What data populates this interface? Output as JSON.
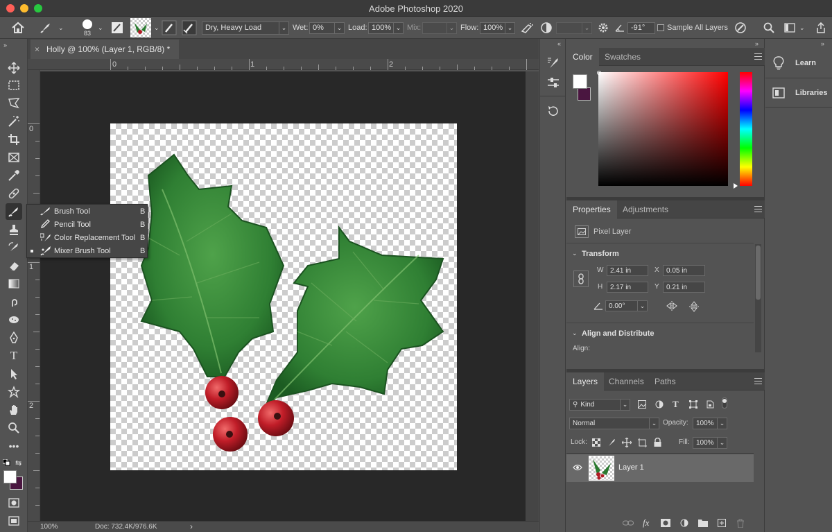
{
  "app": {
    "title": "Adobe Photoshop 2020"
  },
  "options_bar": {
    "brush_size": "83",
    "mix_preset": "Dry, Heavy Load",
    "wet_label": "Wet:",
    "wet_value": "0%",
    "load_label": "Load:",
    "load_value": "100%",
    "mix_label": "Mix:",
    "mix_value": "",
    "flow_label": "Flow:",
    "flow_value": "100%",
    "angle_value": "-91°",
    "sample_all_layers": "Sample All Layers"
  },
  "document": {
    "tab_title": "Holly @ 100% (Layer 1, RGB/8) *",
    "close_glyph": "×",
    "ruler_h": [
      "0",
      "1",
      "2"
    ],
    "ruler_v": [
      "0",
      "1",
      "2"
    ],
    "zoom": "100%",
    "doc_info": "Doc: 732.4K/976.6K",
    "status_arrow": "›"
  },
  "tool_flyout": {
    "items": [
      {
        "label": "Brush Tool",
        "key": "B",
        "icon": "brush-icon",
        "active": false
      },
      {
        "label": "Pencil Tool",
        "key": "B",
        "icon": "pencil-icon",
        "active": false
      },
      {
        "label": "Color Replacement Tool",
        "key": "B",
        "icon": "color-replacement-icon",
        "active": false
      },
      {
        "label": "Mixer Brush Tool",
        "key": "B",
        "icon": "mixer-brush-icon",
        "active": true
      }
    ]
  },
  "color_panel": {
    "tabs": [
      "Color",
      "Swatches"
    ],
    "foreground": "#ffffff",
    "background": "#4a1640"
  },
  "properties_panel": {
    "tabs": [
      "Properties",
      "Adjustments"
    ],
    "layer_type": "Pixel Layer",
    "transform_title": "Transform",
    "w_label": "W",
    "w_value": "2.41 in",
    "h_label": "H",
    "h_value": "2.17 in",
    "x_label": "X",
    "x_value": "0.05 in",
    "y_label": "Y",
    "y_value": "0.21 in",
    "angle_value": "0.00°",
    "align_title": "Align and Distribute",
    "align_label": "Align:"
  },
  "layers_panel": {
    "tabs": [
      "Layers",
      "Channels",
      "Paths"
    ],
    "filter_kind": "Kind",
    "blend_mode": "Normal",
    "opacity_label": "Opacity:",
    "opacity_value": "100%",
    "lock_label": "Lock:",
    "fill_label": "Fill:",
    "fill_value": "100%",
    "layers": [
      {
        "name": "Layer 1",
        "visible": true
      }
    ]
  },
  "right_panel": {
    "items": [
      {
        "label": "Learn",
        "icon": "lightbulb-icon"
      },
      {
        "label": "Libraries",
        "icon": "libraries-icon"
      }
    ]
  },
  "colors": {
    "ui_bg": "#535353",
    "canvas_bg": "#282828",
    "leaf_green": "#2e8a3a",
    "berry_red": "#c21e2a"
  }
}
